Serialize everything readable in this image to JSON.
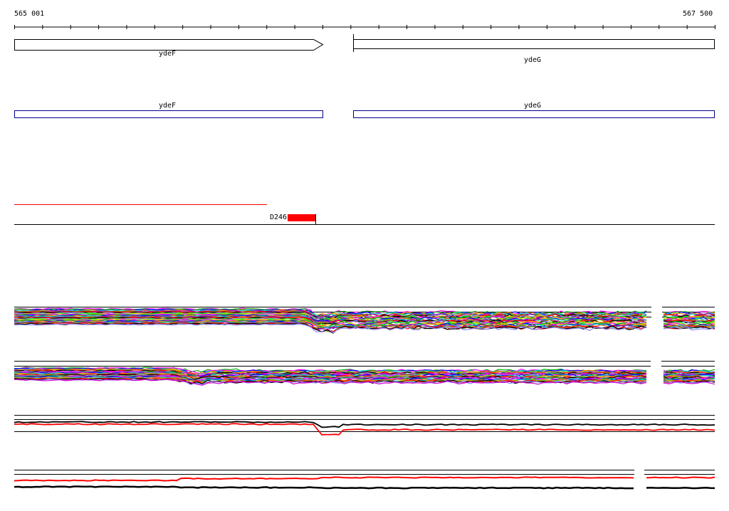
{
  "ruler": {
    "start_label": "565 001",
    "end_label": "567 500"
  },
  "genes": [
    {
      "name": "ydeF",
      "strand": "+"
    },
    {
      "name": "ydeG",
      "strand": "-"
    }
  ],
  "annotations": [
    {
      "name": "ydeF",
      "color": "#00008b"
    },
    {
      "name": "ydeG",
      "color": "#00008b"
    }
  ],
  "feature": {
    "label": "D246",
    "color": "#ff0000"
  },
  "colors": {
    "accent_red": "#ff0000",
    "gene_outline": "#000000",
    "annotation_outline": "#00008b"
  },
  "tracks": [
    {
      "type": "multi-line",
      "palette": [
        "#ff00ff",
        "#00aa00",
        "#0000ff",
        "#ff8800",
        "#00cccc",
        "#aa00aa",
        "#888800",
        "#ff0000",
        "#000000",
        "#8888ff",
        "#00ff00",
        "#ffcc00"
      ]
    },
    {
      "type": "multi-line",
      "palette": [
        "#00aa00",
        "#ff00ff",
        "#0000ff",
        "#00cccc",
        "#ff8800",
        "#aaaa00",
        "#ff0000",
        "#000000",
        "#8888ff",
        "#cc00cc"
      ]
    },
    {
      "type": "two-line",
      "palette": [
        "#000000",
        "#ff0000"
      ]
    },
    {
      "type": "two-line",
      "palette": [
        "#ff0000",
        "#000000"
      ]
    }
  ]
}
